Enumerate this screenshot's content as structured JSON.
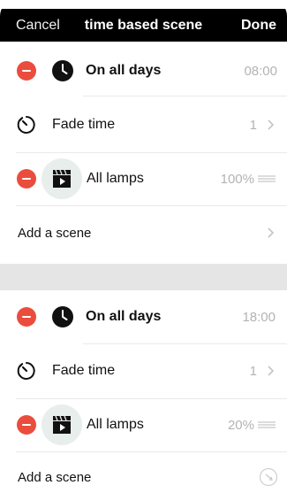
{
  "nav": {
    "cancel": "Cancel",
    "title": "time based scene",
    "done": "Done"
  },
  "sections": [
    {
      "days": {
        "label": "On all days",
        "time": "08:00"
      },
      "fade": {
        "label": "Fade time",
        "value": "1"
      },
      "lamps": {
        "label": "All lamps",
        "value": "100%"
      },
      "add": {
        "label": "Add a scene"
      }
    },
    {
      "days": {
        "label": "On all days",
        "time": "18:00"
      },
      "fade": {
        "label": "Fade time",
        "value": "1"
      },
      "lamps": {
        "label": "All lamps",
        "value": "20%"
      },
      "add": {
        "label": "Add a scene"
      }
    }
  ],
  "icons": {
    "delete": "minus-circle-icon",
    "schedule": "clock-icon",
    "fade": "timer-icon",
    "scene": "film-clapper-icon",
    "reorder": "reorder-grip-icon",
    "disclosure": "chevron-right-icon"
  },
  "colors": {
    "navbar": "#000000",
    "delete": "#ea4d3d",
    "secondary_text": "#b3b3b3",
    "section_gap": "#e5e5e5",
    "scene_icon_bg": "#e7eeec"
  }
}
